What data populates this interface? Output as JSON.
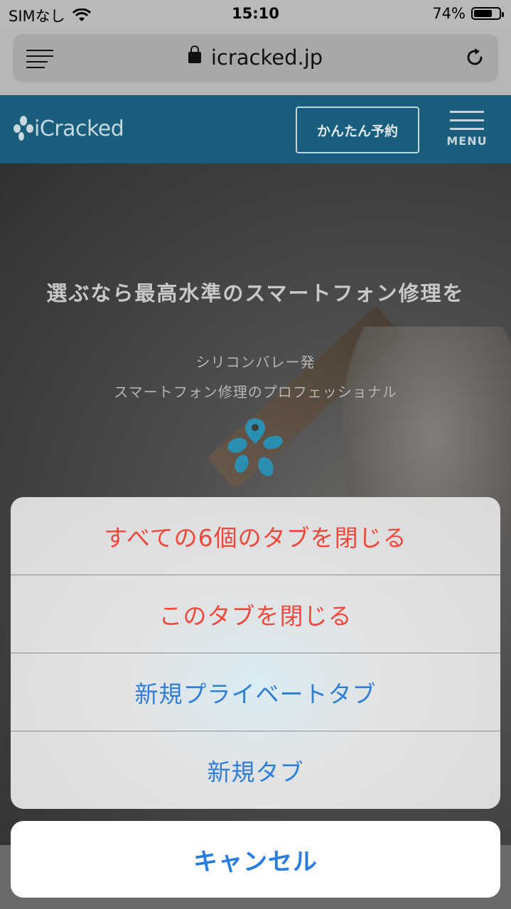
{
  "status_bar": {
    "carrier": "SIMなし",
    "time": "15:10",
    "battery_percent": "74%",
    "battery_level": 0.74
  },
  "browser": {
    "url": "icracked.jp",
    "reader_icon": "reader-lines-icon",
    "lock_icon": "lock-icon",
    "reload_icon": "reload-icon"
  },
  "site_header": {
    "logo_text": "iCracked",
    "reserve_label": "かんたん予約",
    "menu_label": "MENU",
    "brand_color": "#1a5e7e"
  },
  "hero": {
    "headline": "選ぶなら最高水準のスマートフォン修理を",
    "sub_line1": "シリコンバレー発",
    "sub_line2": "スマートフォン修理のプロフェッショナル"
  },
  "action_sheet": {
    "items": [
      {
        "label": "すべての6個のタブを閉じる",
        "style": "destructive"
      },
      {
        "label": "このタブを閉じる",
        "style": "destructive"
      },
      {
        "label": "新規プライベートタブ",
        "style": "normal"
      },
      {
        "label": "新規タブ",
        "style": "normal"
      }
    ],
    "cancel_label": "キャンセル",
    "destructive_color": "#f0493c",
    "normal_color": "#2f7fd8"
  }
}
